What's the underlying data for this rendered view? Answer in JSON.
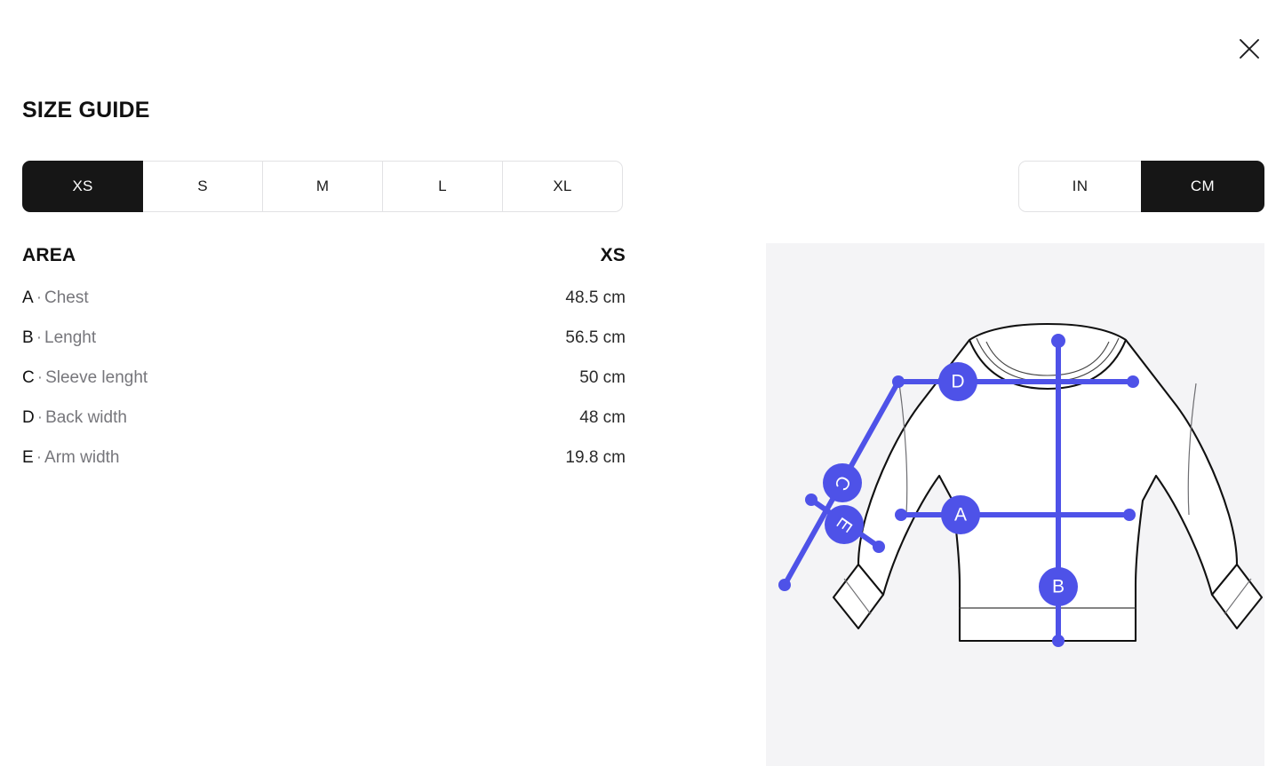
{
  "header": {
    "title": "SIZE GUIDE",
    "close_icon": "close-icon"
  },
  "size_selector": {
    "selected": "XS",
    "options": [
      {
        "label": "XS",
        "selected": true
      },
      {
        "label": "S",
        "selected": false
      },
      {
        "label": "M",
        "selected": false
      },
      {
        "label": "L",
        "selected": false
      },
      {
        "label": "XL",
        "selected": false
      }
    ]
  },
  "unit_selector": {
    "selected": "CM",
    "options": [
      {
        "label": "IN",
        "selected": false
      },
      {
        "label": "CM",
        "selected": true
      }
    ]
  },
  "table": {
    "header": {
      "area": "AREA",
      "size": "XS"
    },
    "separator": "·",
    "rows": [
      {
        "key": "A",
        "name": "Chest",
        "value": "48.5 cm"
      },
      {
        "key": "B",
        "name": "Lenght",
        "value": "56.5 cm"
      },
      {
        "key": "C",
        "name": "Sleeve lenght",
        "value": "50 cm"
      },
      {
        "key": "D",
        "name": "Back width",
        "value": "48 cm"
      },
      {
        "key": "E",
        "name": "Arm width",
        "value": "19.8 cm"
      }
    ]
  },
  "diagram": {
    "garment": "crewneck-sweatshirt",
    "panel_bg": "#f4f4f6",
    "accent_color": "#4e52e8",
    "outline_color": "#111111",
    "markers": [
      {
        "id": "A",
        "label": "A",
        "measure": "Chest"
      },
      {
        "id": "B",
        "label": "B",
        "measure": "Lenght"
      },
      {
        "id": "C",
        "label": "C",
        "measure": "Sleeve lenght"
      },
      {
        "id": "D",
        "label": "D",
        "measure": "Back width"
      },
      {
        "id": "E",
        "label": "E",
        "measure": "Arm width"
      }
    ]
  },
  "colors": {
    "accent": "#4e52e8",
    "active_bg": "#161616",
    "panel_bg": "#f4f4f6",
    "muted_text": "#76767b",
    "border": "#e2e2e4"
  }
}
